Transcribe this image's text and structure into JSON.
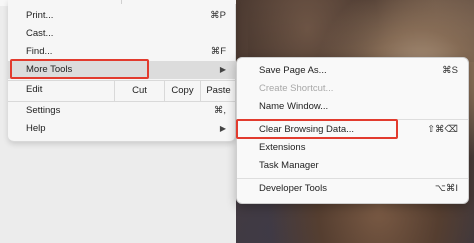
{
  "main_menu": {
    "items": {
      "print": {
        "label": "Print...",
        "shortcut": "⌘P"
      },
      "cast": {
        "label": "Cast..."
      },
      "find": {
        "label": "Find...",
        "shortcut": "⌘F"
      },
      "more_tools": {
        "label": "More Tools",
        "arrow": "▶"
      },
      "edit": {
        "label": "Edit",
        "cut": "Cut",
        "copy": "Copy",
        "paste": "Paste"
      },
      "settings": {
        "label": "Settings",
        "shortcut": "⌘,"
      },
      "help": {
        "label": "Help",
        "arrow": "▶"
      }
    }
  },
  "sub_menu": {
    "items": {
      "save_page": {
        "label": "Save Page As...",
        "shortcut": "⌘S"
      },
      "create_shortcut": {
        "label": "Create Shortcut...",
        "disabled": true
      },
      "name_window": {
        "label": "Name Window..."
      },
      "clear_data": {
        "label": "Clear Browsing Data...",
        "shortcut": "⇧⌘⌫"
      },
      "extensions": {
        "label": "Extensions"
      },
      "task_manager": {
        "label": "Task Manager"
      },
      "dev_tools": {
        "label": "Developer Tools",
        "shortcut": "⌥⌘I"
      }
    }
  },
  "colors": {
    "highlight_box": "#e23b2e",
    "menu_bg": "#f6f6f6",
    "hover_bg": "#dcdcdc"
  }
}
